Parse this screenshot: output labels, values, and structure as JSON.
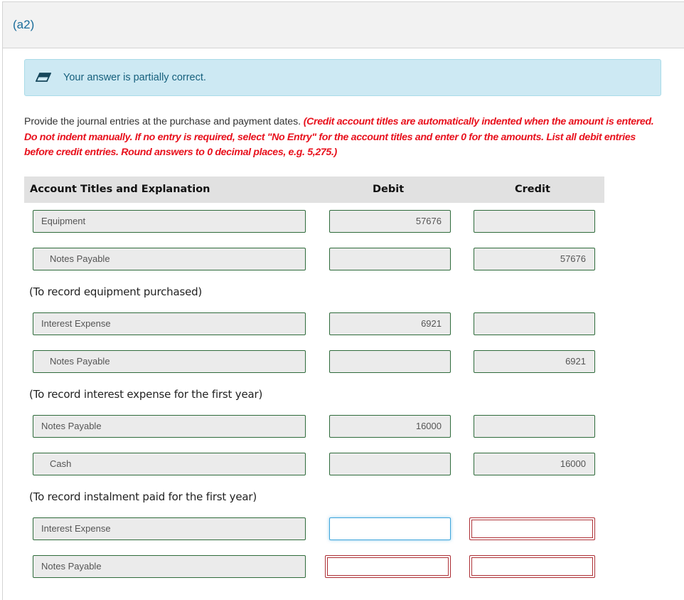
{
  "section": {
    "label": "(a2)"
  },
  "feedback": {
    "icon": "eraser-icon",
    "text": "Your answer is partially correct."
  },
  "instructions": {
    "plain": "Provide the journal entries at the purchase and payment dates. ",
    "emphasis": "(Credit account titles are automatically indented when the amount is entered. Do not indent manually. If no entry is required, select \"No Entry\" for the account titles and enter 0 for the amounts. List all debit entries before credit entries. Round answers to 0 decimal places, e.g. 5,275.)"
  },
  "table": {
    "headers": {
      "account": "Account Titles and Explanation",
      "debit": "Debit",
      "credit": "Credit"
    },
    "entries": [
      {
        "rows": [
          {
            "account": "Equipment",
            "debit": "57676",
            "credit": ""
          },
          {
            "account": "Notes Payable",
            "debit": "",
            "credit": "57676"
          }
        ],
        "memo": "(To record equipment purchased)"
      },
      {
        "rows": [
          {
            "account": "Interest Expense",
            "debit": "6921",
            "credit": ""
          },
          {
            "account": "Notes Payable",
            "debit": "",
            "credit": "6921"
          }
        ],
        "memo": "(To record interest expense for the first year)"
      },
      {
        "rows": [
          {
            "account": "Notes Payable",
            "debit": "16000",
            "credit": ""
          },
          {
            "account": "Cash",
            "debit": "",
            "credit": "16000"
          }
        ],
        "memo": "(To record instalment paid for the first year)"
      },
      {
        "rows": [
          {
            "account": "Interest Expense",
            "debit": "",
            "credit": ""
          },
          {
            "account": "Notes Payable",
            "debit": "",
            "credit": ""
          }
        ]
      }
    ]
  },
  "colors": {
    "accent": "#1a6d9b",
    "feedback_bg": "#cde9f3",
    "instruction_red": "#e8111d",
    "correct_border": "#2f6b3b",
    "error_border": "#ad3036",
    "focus_border": "#3ea6dc"
  }
}
